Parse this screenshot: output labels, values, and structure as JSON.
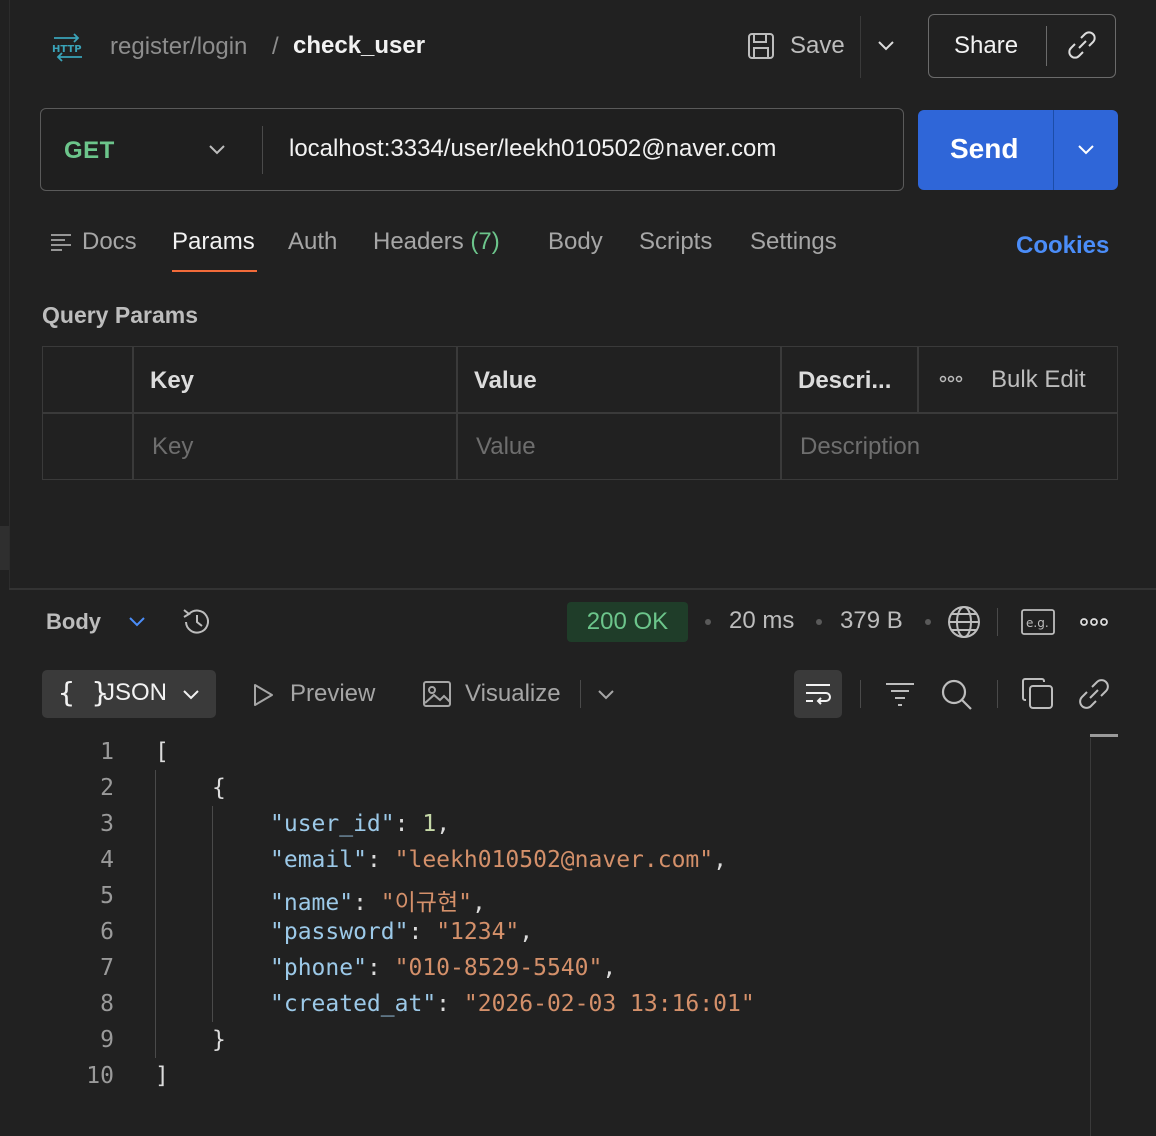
{
  "header": {
    "breadcrumb_parent": "register/login",
    "breadcrumb_sep": "/",
    "title": "check_user",
    "save_label": "Save",
    "share_label": "Share"
  },
  "request": {
    "method": "GET",
    "url": "localhost:3334/user/leekh010502@naver.com",
    "send_label": "Send"
  },
  "tabs": {
    "items": [
      {
        "label": "Docs"
      },
      {
        "label": "Params",
        "active": true
      },
      {
        "label": "Auth"
      },
      {
        "label": "Headers",
        "badge": "(7)"
      },
      {
        "label": "Body"
      },
      {
        "label": "Scripts"
      },
      {
        "label": "Settings"
      }
    ],
    "cookies": "Cookies"
  },
  "query_params": {
    "title": "Query Params",
    "columns": [
      "Key",
      "Value",
      "Descri..."
    ],
    "placeholders": [
      "Key",
      "Value",
      "Description"
    ],
    "bulk_edit": "Bulk Edit"
  },
  "response": {
    "body_label": "Body",
    "status": "200 OK",
    "time": "20 ms",
    "size": "379 B",
    "format": "JSON",
    "preview": "Preview",
    "visualize": "Visualize",
    "line_numbers": [
      "1",
      "2",
      "3",
      "4",
      "5",
      "6",
      "7",
      "8",
      "9",
      "10"
    ],
    "json": {
      "open_bracket": "[",
      "open_brace": "{",
      "fields": [
        {
          "key": "\"user_id\"",
          "value": "1",
          "type": "number",
          "comma": ","
        },
        {
          "key": "\"email\"",
          "value": "\"leekh010502@naver.com\"",
          "type": "string",
          "comma": ","
        },
        {
          "key": "\"name\"",
          "value": "\"이규현\"",
          "type": "string",
          "comma": ","
        },
        {
          "key": "\"password\"",
          "value": "\"1234\"",
          "type": "string",
          "comma": ","
        },
        {
          "key": "\"phone\"",
          "value": "\"010-8529-5540\"",
          "type": "string",
          "comma": ","
        },
        {
          "key": "\"created_at\"",
          "value": "\"2026-02-03 13:16:01\"",
          "type": "string",
          "comma": ""
        }
      ],
      "close_brace": "}",
      "close_bracket": "]"
    }
  },
  "colors": {
    "accent_send": "#2f66d8",
    "method_get": "#6cc58b",
    "tab_underline": "#f26b3a",
    "cookies_link": "#4b8df8",
    "status_ok_bg": "#1f3d29"
  }
}
